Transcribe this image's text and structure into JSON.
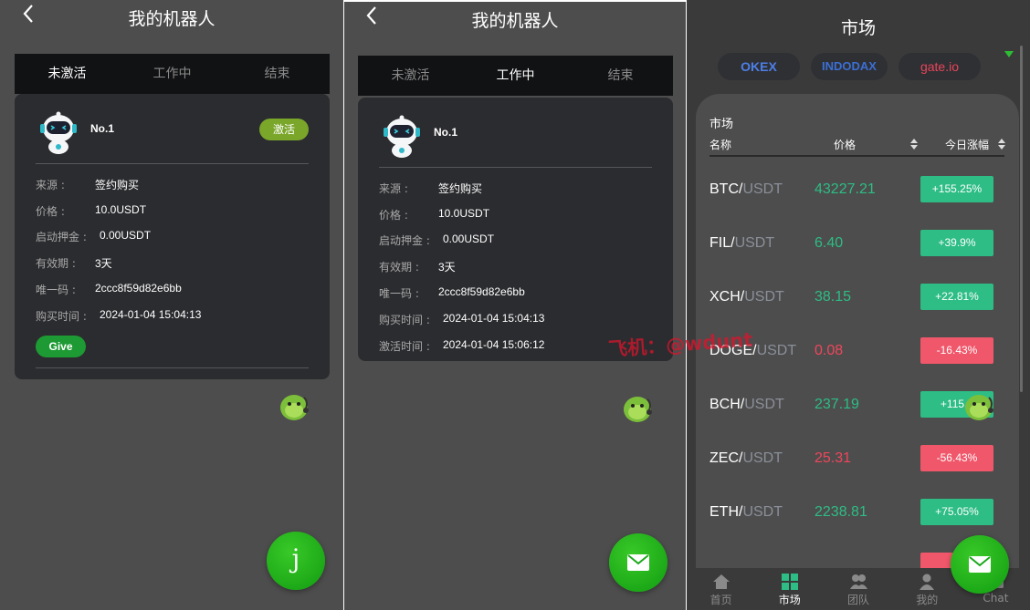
{
  "panel1": {
    "title": "我的机器人",
    "tabs": [
      "未激活",
      "工作中",
      "结束"
    ],
    "robot": {
      "name": "No.1",
      "action_label": "激活",
      "rows": [
        {
          "label": "来源 :",
          "value": "签约购买"
        },
        {
          "label": "价格 :",
          "value": "10.0USDT"
        },
        {
          "label": "启动押金 :",
          "value": "0.00USDT"
        },
        {
          "label": "有效期 :",
          "value": "3天"
        },
        {
          "label": "唯一码 :",
          "value": "2ccc8f59d82e6bb"
        },
        {
          "label": "购买时间 :",
          "value": "2024-01-04 15:04:13"
        }
      ],
      "give_label": "Give"
    },
    "fab_glyph": "j"
  },
  "panel2": {
    "title": "我的机器人",
    "tabs": [
      "未激活",
      "工作中",
      "结束"
    ],
    "robot": {
      "name": "No.1",
      "rows": [
        {
          "label": "来源 :",
          "value": "签约购买"
        },
        {
          "label": "价格 :",
          "value": "10.0USDT"
        },
        {
          "label": "启动押金 :",
          "value": "0.00USDT"
        },
        {
          "label": "有效期 :",
          "value": "3天"
        },
        {
          "label": "唯一码 :",
          "value": "2ccc8f59d82e6bb"
        },
        {
          "label": "购买时间 :",
          "value": "2024-01-04 15:04:13"
        },
        {
          "label": "激活时间 :",
          "value": "2024-01-04 15:06:12"
        }
      ]
    }
  },
  "panel3": {
    "title": "市场",
    "exchanges": [
      "OKEX",
      "INDODAX",
      "gate.io"
    ],
    "market": {
      "title": "市场",
      "col_name": "名称",
      "col_price": "价格",
      "col_change": "今日涨幅",
      "rows": [
        {
          "base": "BTC/",
          "quote": "USDT",
          "price": "43227.21",
          "change": "+155.25%",
          "dir": "up"
        },
        {
          "base": "FIL/",
          "quote": "USDT",
          "price": "6.40",
          "change": "+39.9%",
          "dir": "up"
        },
        {
          "base": "XCH/",
          "quote": "USDT",
          "price": "38.15",
          "change": "+22.81%",
          "dir": "up"
        },
        {
          "base": "DOGE/",
          "quote": "USDT",
          "price": "0.08",
          "change": "-16.43%",
          "dir": "dn"
        },
        {
          "base": "BCH/",
          "quote": "USDT",
          "price": "237.19",
          "change": "+115.2",
          "dir": "up"
        },
        {
          "base": "ZEC/",
          "quote": "USDT",
          "price": "25.31",
          "change": "-56.43%",
          "dir": "dn"
        },
        {
          "base": "ETH/",
          "quote": "USDT",
          "price": "2238.81",
          "change": "+75.05%",
          "dir": "up"
        }
      ]
    },
    "nav": [
      {
        "label": "首页",
        "icon": "home-icon"
      },
      {
        "label": "市场",
        "icon": "market-grid-icon"
      },
      {
        "label": "团队",
        "icon": "team-icon"
      },
      {
        "label": "我的",
        "icon": "user-icon"
      },
      {
        "label": "Chat",
        "icon": "mail-icon"
      }
    ],
    "active_nav": "市场"
  },
  "watermark": "飞机：@wdunt",
  "colors": {
    "up": "#2dbd85",
    "down": "#f0465b",
    "fab_green": "#1aa81a",
    "activate_button": "#7aa62a",
    "give_button": "#1d9a33"
  }
}
